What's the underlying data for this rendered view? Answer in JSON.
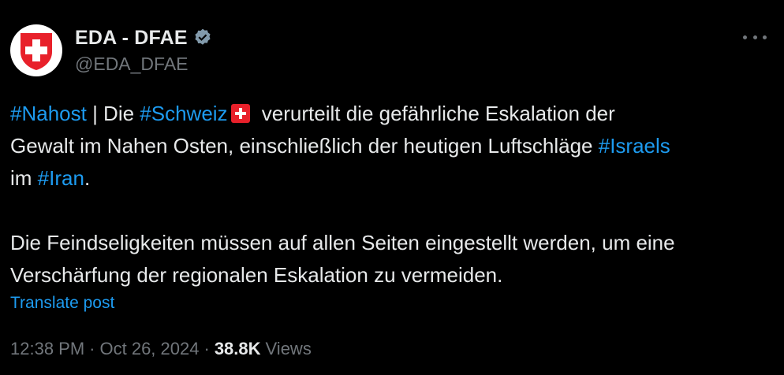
{
  "author": {
    "name": "EDA - DFAE",
    "handle": "@EDA_DFAE",
    "verified_icon": "verified-badge-icon",
    "avatar_icon": "swiss-cross-shield-icon"
  },
  "colors": {
    "background": "#000000",
    "text": "#e7e9ea",
    "muted": "#71767b",
    "link": "#1d9bf0",
    "swiss_red": "#e8202a"
  },
  "body": {
    "hashtag_nahost": "#Nahost",
    "text_1": " | Die ",
    "hashtag_schweiz": "#Schweiz",
    "text_2": " verurteilt die gefährliche Eskalation der\nGewalt im Nahen Osten, einschließlich der heutigen Luftschläge ",
    "hashtag_israels": "#Israels",
    "text_3": "\nim ",
    "hashtag_iran": "#Iran",
    "text_4": ".\n\nDie Feindseligkeiten müssen auf allen Seiten eingestellt werden, um eine\nVerschärfung der regionalen Eskalation zu vermeiden.",
    "flag_icon": "swiss-flag-icon"
  },
  "translate_label": "Translate post",
  "meta": {
    "time": "12:38 PM",
    "date": "Oct 26, 2024",
    "separator": "·",
    "views_count": "38.8K",
    "views_label": "Views"
  },
  "more_icon": "more-options-icon"
}
